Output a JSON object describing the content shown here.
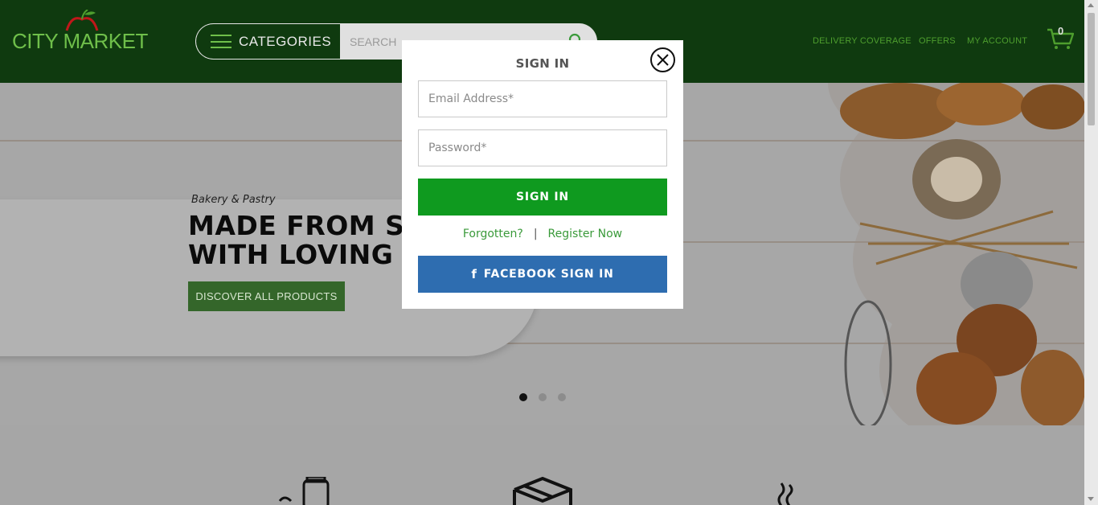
{
  "header": {
    "logo_text": "CITY MARKET",
    "categories_label": "CATEGORIES",
    "search_placeholder": "SEARCH",
    "nav": {
      "delivery": "DELIVERY COVERAGE",
      "offers": "OFFERS",
      "account": "MY ACCOUNT"
    },
    "cart_count": "0"
  },
  "hero": {
    "subtitle": "Bakery & Pastry",
    "headline_line1": "MADE FROM SCI",
    "headline_line2": "WITH LOVING CA",
    "cta_label": "DISCOVER ALL PRODUCTS",
    "slides_total": 3,
    "active_slide": 1
  },
  "modal": {
    "title": "SIGN IN",
    "email_placeholder": "Email Address*",
    "password_placeholder": "Password*",
    "signin_label": "SIGN IN",
    "forgotten_label": "Forgotten?",
    "separator": "|",
    "register_label": "Register Now",
    "facebook_icon": "f",
    "facebook_label": "FACEBOOK SIGN IN"
  },
  "colors": {
    "header_bg": "#0f3a0f",
    "brand_green": "#6fbf4a",
    "signin_green": "#0f9a1f",
    "facebook_blue": "#2e6db0",
    "cta_green": "#34662a"
  },
  "icons": [
    "apple-logo-icon",
    "hamburger-icon",
    "search-icon",
    "cart-icon",
    "close-icon",
    "facebook-icon",
    "milk-bottle-icon",
    "box-icon",
    "steam-icon"
  ]
}
